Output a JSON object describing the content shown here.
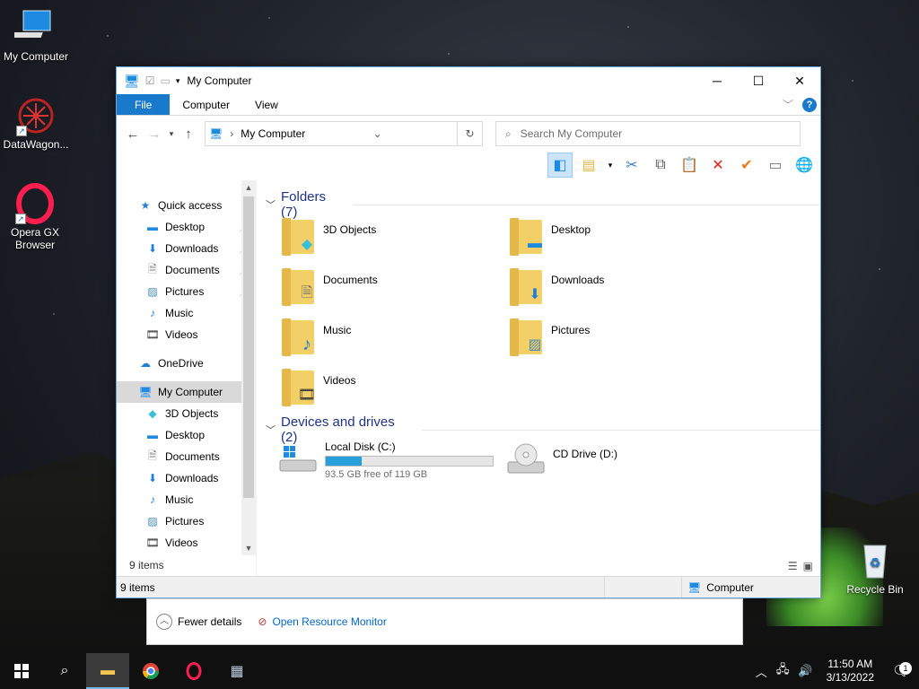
{
  "desktop": {
    "icons": [
      {
        "label": "My Computer"
      },
      {
        "label": "DataWagon..."
      },
      {
        "label": "Opera GX Browser"
      },
      {
        "label": "Recycle Bin"
      }
    ]
  },
  "window": {
    "title": "My Computer",
    "tabs": {
      "file": "File",
      "computer": "Computer",
      "view": "View"
    },
    "help_symbol": "?",
    "address": "My Computer",
    "search_placeholder": "Search My Computer",
    "nav": {
      "quick_access": "Quick access",
      "quick_items": [
        "Desktop",
        "Downloads",
        "Documents",
        "Pictures",
        "Music",
        "Videos"
      ],
      "onedrive": "OneDrive",
      "my_computer": "My Computer",
      "computer_items": [
        "3D Objects",
        "Desktop",
        "Documents",
        "Downloads",
        "Music",
        "Pictures",
        "Videos"
      ]
    },
    "folders_header": "Folders (7)",
    "folders": [
      {
        "name": "3D Objects",
        "icon": "cube-icon"
      },
      {
        "name": "Desktop",
        "icon": "monitor-icon"
      },
      {
        "name": "Documents",
        "icon": "document-icon"
      },
      {
        "name": "Downloads",
        "icon": "download-arrow-icon"
      },
      {
        "name": "Music",
        "icon": "music-note-icon"
      },
      {
        "name": "Pictures",
        "icon": "picture-icon"
      },
      {
        "name": "Videos",
        "icon": "film-icon"
      }
    ],
    "drives_header": "Devices and drives (2)",
    "drives": [
      {
        "name": "Local Disk (C:)",
        "free": "93.5 GB free of 119 GB",
        "used_fraction": 0.214
      },
      {
        "name": "CD Drive (D:)"
      }
    ],
    "status_items": "9 items",
    "statusbar": {
      "items": "9 items",
      "location": "Computer"
    }
  },
  "task_manager": {
    "fewer_details": "Fewer details",
    "open_resource_monitor": "Open Resource Monitor"
  },
  "taskbar": {
    "time": "11:50 AM",
    "date": "3/13/2022",
    "notification_count": "1"
  },
  "colors": {
    "accent": "#1979ca",
    "progress": "#26a0da",
    "header_text": "#1e3287"
  }
}
